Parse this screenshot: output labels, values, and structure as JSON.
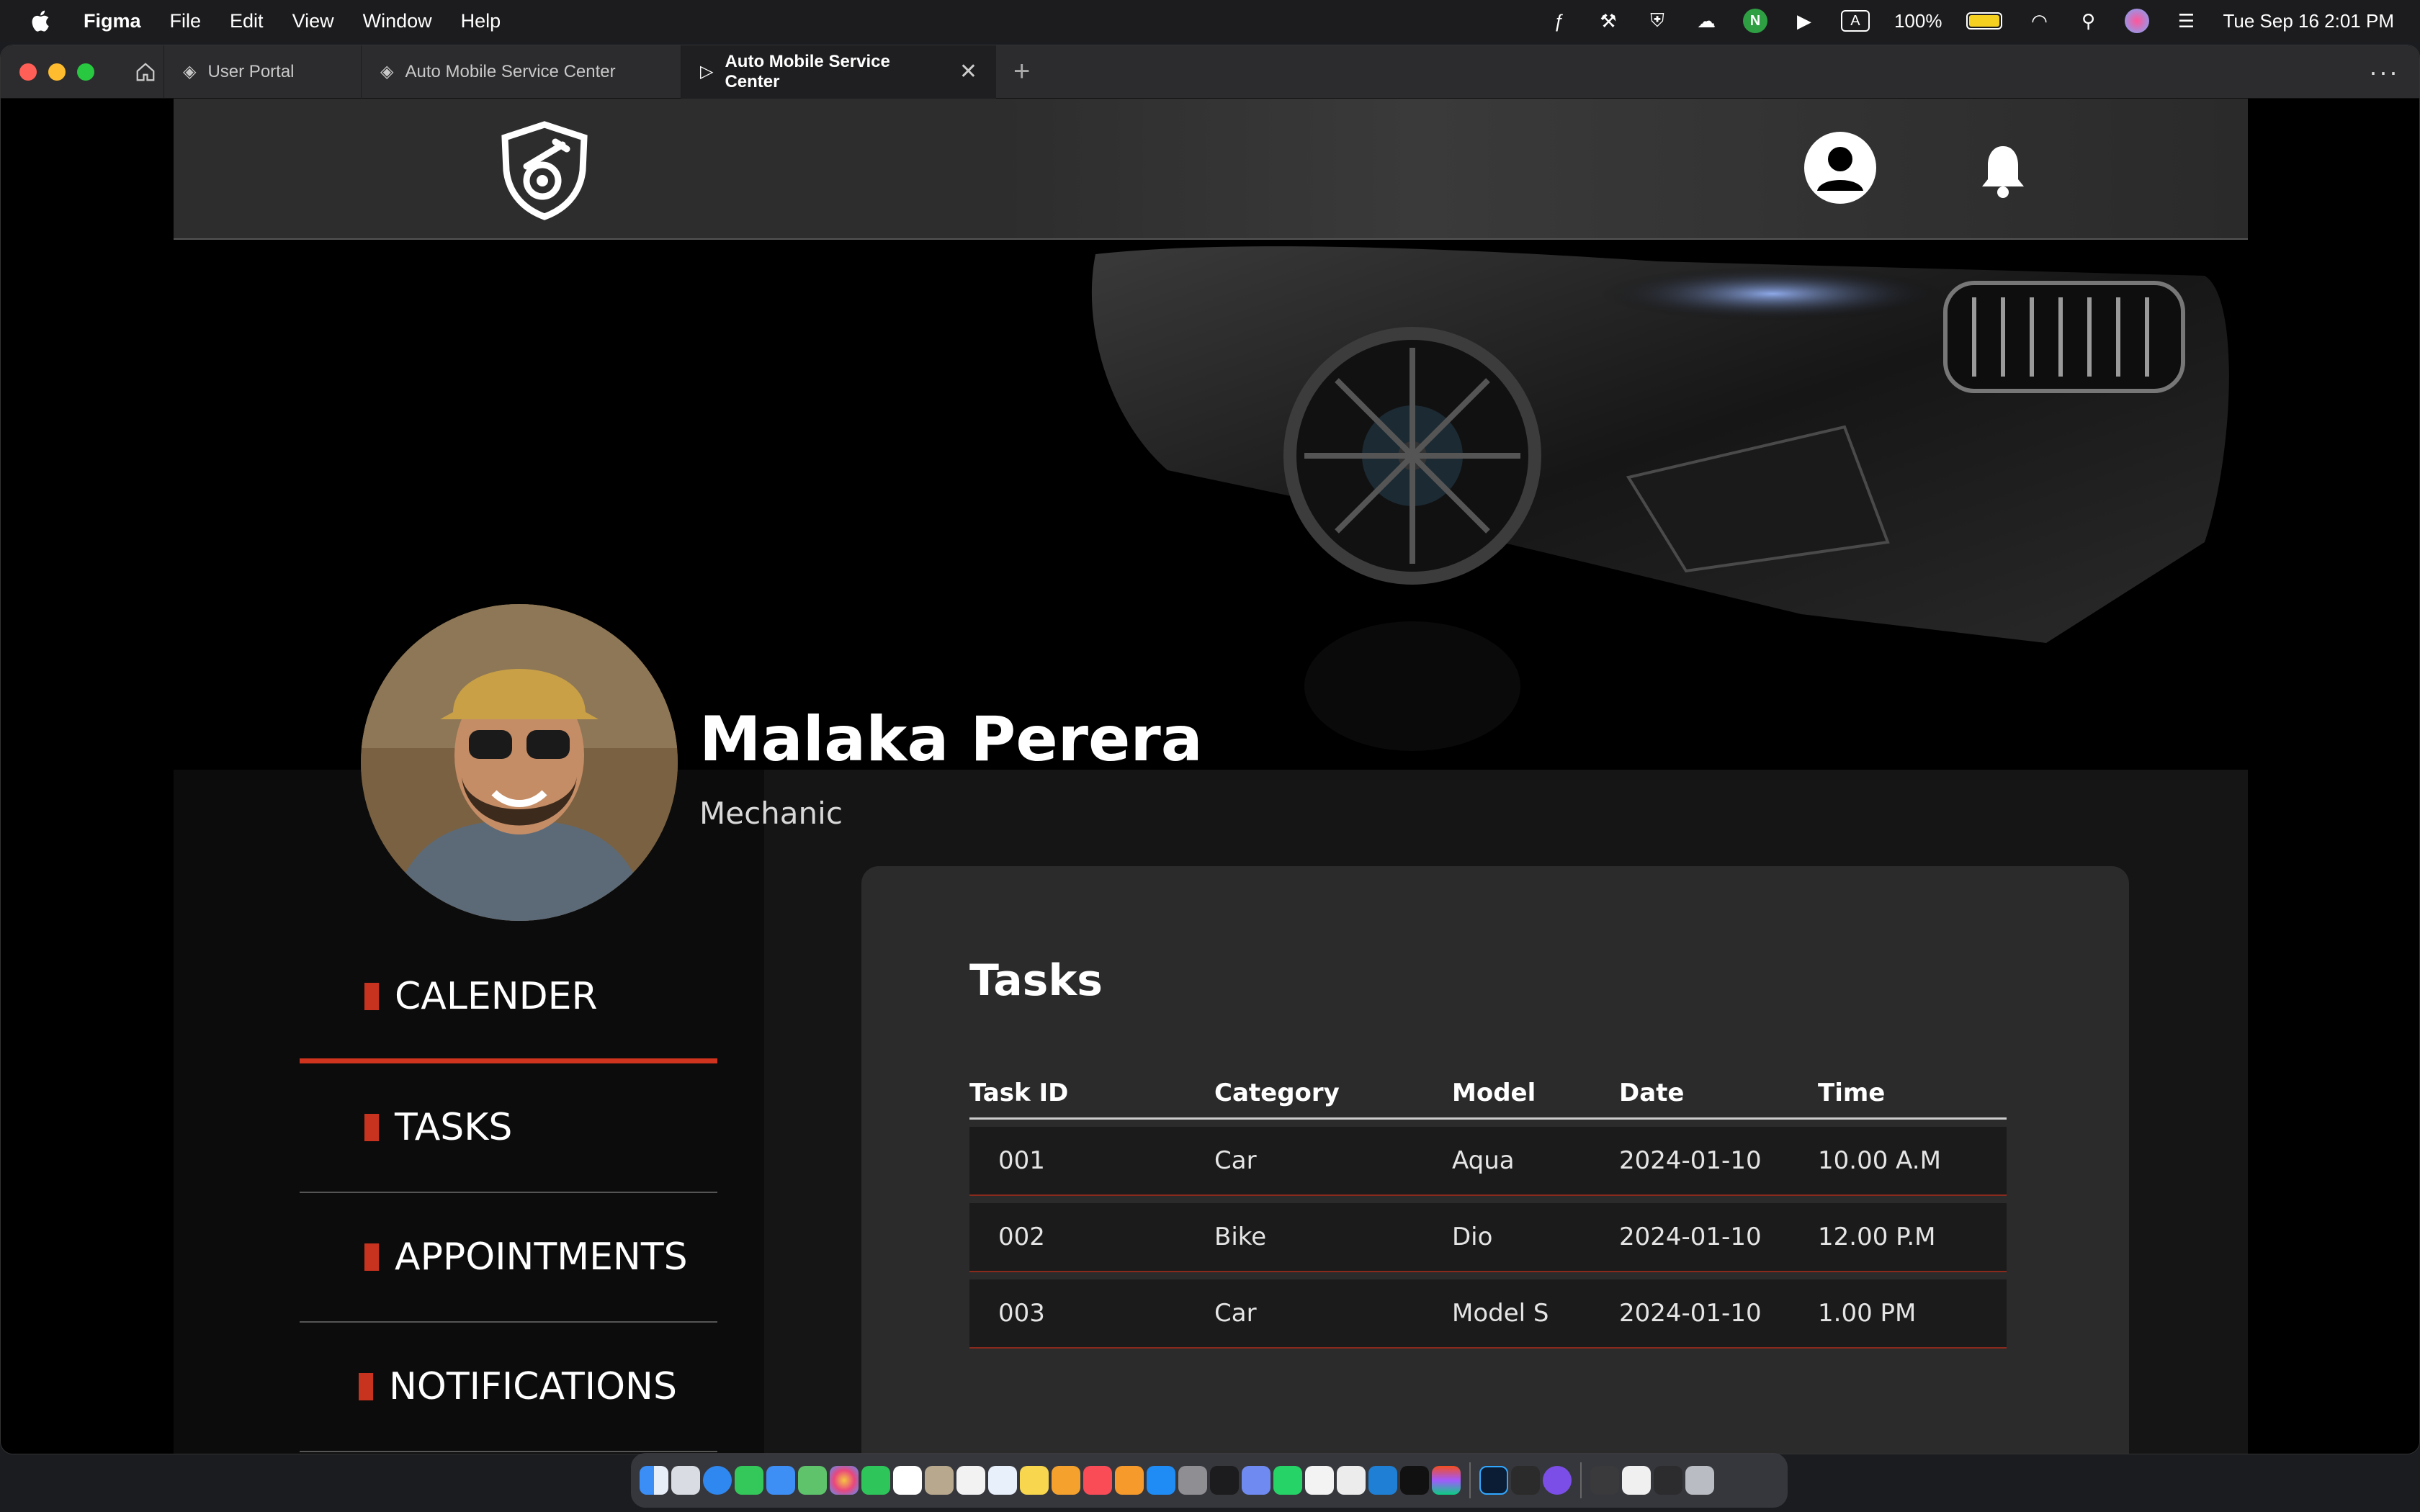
{
  "menubar": {
    "app_name": "Figma",
    "menus": [
      "File",
      "Edit",
      "View",
      "Window",
      "Help"
    ],
    "battery": "100%",
    "datetime": "Tue Sep 16  2:01 PM"
  },
  "tabs": [
    {
      "label": "User Portal"
    },
    {
      "label": "Auto Mobile Service Center"
    },
    {
      "label": "Auto Mobile Service Center",
      "active": true
    }
  ],
  "profile": {
    "name": "Malaka Perera",
    "role": "Mechanic"
  },
  "nav": {
    "items": [
      {
        "label": "CALENDER",
        "active": true
      },
      {
        "label": "TASKS"
      },
      {
        "label": "APPOINTMENTS"
      },
      {
        "label": "NOTIFICATIONS"
      }
    ]
  },
  "tasks": {
    "title": "Tasks",
    "columns": [
      "Task ID",
      "Category",
      "Model",
      "Date",
      "Time"
    ],
    "rows": [
      [
        "001",
        "Car",
        "Aqua",
        "2024-01-10",
        "10.00 A.M"
      ],
      [
        "002",
        "Bike",
        "Dio",
        "2024-01-10",
        "12.00 P.M"
      ],
      [
        "003",
        "Car",
        "Model S",
        "2024-01-10",
        "1.00 PM"
      ]
    ]
  },
  "colors": {
    "accent_red": "#d0341f",
    "header_bg": "#2d2d2d",
    "card_bg": "#2b2b2b"
  },
  "icons": {
    "logo": "shield-wrench-logo",
    "profile": "user-avatar-icon",
    "notifications": "bell-icon"
  }
}
